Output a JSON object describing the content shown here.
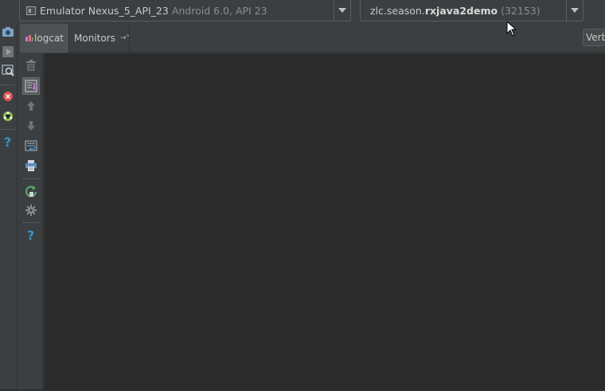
{
  "device_selector": {
    "icon": "device-icon",
    "name": "Emulator Nexus_5_API_23",
    "detail": "Android 6.0, API 23"
  },
  "process_selector": {
    "prefix": "zlc.season.",
    "package": "rxjava2demo",
    "pid": "(32153)"
  },
  "tabs": [
    {
      "label": "logcat",
      "icon": "logcat-icon"
    },
    {
      "label": "Monitors",
      "icon": "restore-layout-icon",
      "suffix": "→\""
    }
  ],
  "log_level": {
    "label": "Verb"
  },
  "left_toolbar": [
    "camera-icon",
    "screen-record-icon",
    "inspect-icon",
    "stop-icon",
    "android-icon",
    "help-icon"
  ],
  "logcat_toolbar": [
    "trash-icon",
    "scroll-to-end-icon",
    "up-arrow-icon",
    "down-arrow-icon",
    "soft-wrap-icon",
    "print-icon",
    "restart-icon",
    "gear-icon",
    "help-icon"
  ],
  "colors": {
    "background": "#3c3f41",
    "log_background": "#2b2b2b",
    "help_blue": "#3592c4"
  }
}
